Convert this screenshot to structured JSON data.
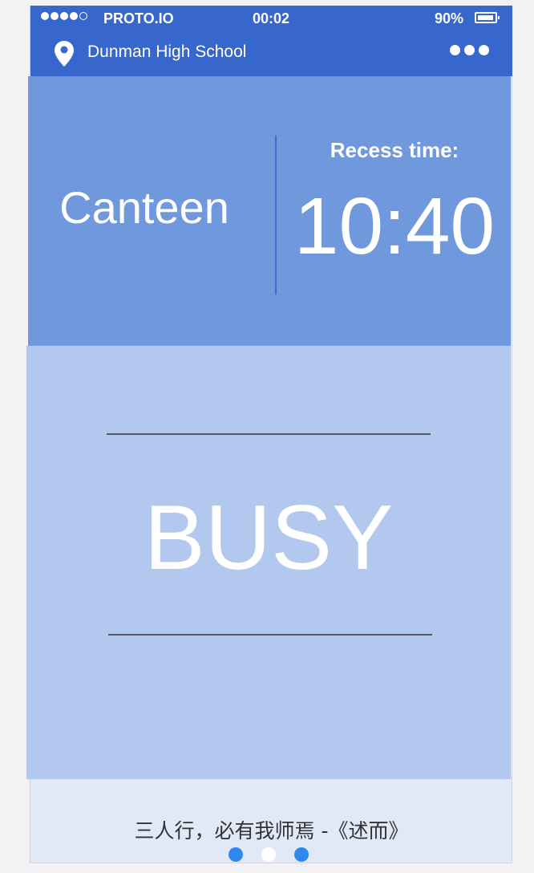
{
  "status_bar": {
    "carrier": "PROTO.IO",
    "time": "00:02",
    "battery": "90%",
    "signal_icon": "signal-dots-icon",
    "battery_icon": "battery-icon"
  },
  "header": {
    "title": "Dunman High School",
    "location_icon": "map-pin-icon",
    "menu_icon": "more-dots-icon"
  },
  "info": {
    "location": "Canteen",
    "recess_label": "Recess time:",
    "recess_time": "10:40"
  },
  "crowd": {
    "status": "BUSY"
  },
  "footer": {
    "quote": "三人行，必有我师焉 -《述而》",
    "pages": 3,
    "active_page": 2
  },
  "colors": {
    "primary": "#3766cc",
    "panel_top": "#7098dd",
    "panel_mid": "#b3c8ef",
    "footer_bg": "#e1e8f6",
    "dot": "#2f88ee"
  }
}
